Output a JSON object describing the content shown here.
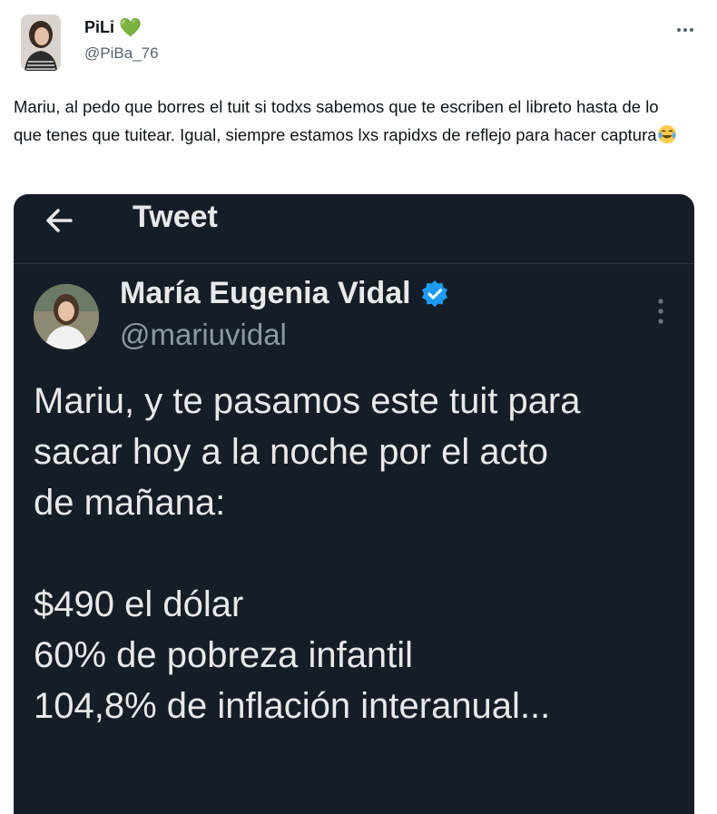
{
  "author": {
    "name": "PiLi",
    "name_emoji": "green-heart",
    "handle": "@PiBa_76"
  },
  "tweet": {
    "text": "Mariu, al pedo que borres el tuit si todxs sabemos que te escriben el libreto hasta de lo que tenes que tuitear. Igual, siempre estamos lxs rapidxs de reflejo para hacer captura",
    "trailing_emoji": "tears-of-joy-emoji"
  },
  "screenshot": {
    "topbar_title": "Tweet",
    "author_name": "María Eugenia Vidal",
    "author_handle": "@mariuvidal",
    "lines": [
      "Mariu, y te pasamos este tuit para",
      "sacar hoy a la noche por el acto",
      "de mañana:",
      "$490 el dólar",
      "60% de pobreza infantil",
      "104,8% de inflación interanual..."
    ]
  },
  "colors": {
    "card_bg": "#151d27",
    "verified_blue": "#1d9bf0",
    "heart_green": "#4caf50",
    "muted_text": "#536471"
  }
}
